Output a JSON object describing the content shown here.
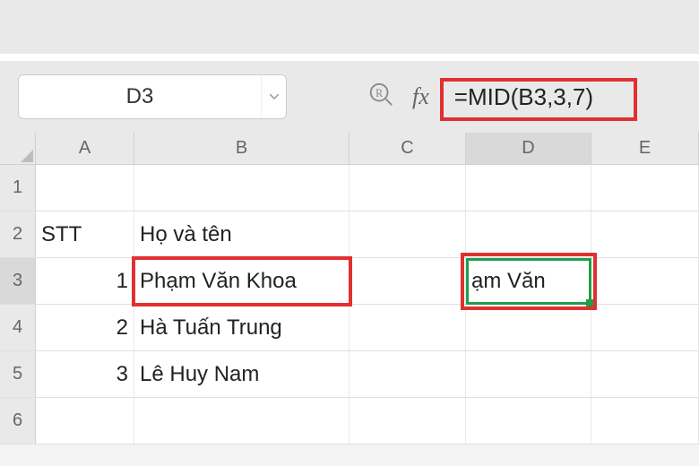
{
  "nameBox": {
    "value": "D3"
  },
  "formulaBar": {
    "formula": "=MID(B3,3,7)"
  },
  "columns": {
    "A": "A",
    "B": "B",
    "C": "C",
    "D": "D",
    "E": "E"
  },
  "rows": {
    "1": "1",
    "2": "2",
    "3": "3",
    "4": "4",
    "5": "5",
    "6": "6"
  },
  "cells": {
    "A2": "STT",
    "B2": "Họ và tên",
    "A3": "1",
    "B3": "Phạm Văn Khoa",
    "D3": "ạm Văn ",
    "A4": "2",
    "B4": "Hà Tuấn Trung",
    "A5": "3",
    "B5": "Lê Huy Nam"
  }
}
